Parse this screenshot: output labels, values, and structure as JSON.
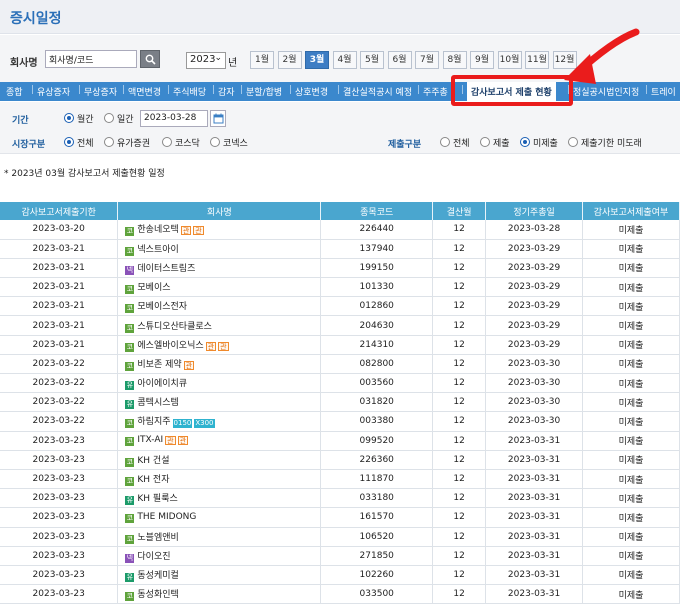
{
  "page": {
    "title": "증시일정"
  },
  "search": {
    "company_label": "회사명",
    "company_value": "회사명/코드",
    "year_value": "2023",
    "year_unit": "년",
    "months": [
      "1월",
      "2월",
      "3월",
      "4월",
      "5월",
      "6월",
      "7월",
      "8월",
      "9월",
      "10월",
      "11월",
      "12월"
    ],
    "active_month": "3월"
  },
  "tabs": [
    "종합",
    "유상증자",
    "무상증자",
    "액면변경",
    "주식배당",
    "감자",
    "분할/합병",
    "상호변경",
    "결산실적공시 예정",
    "주주총",
    "감사보고서 제출 현황",
    "정실공시법인지정",
    "트레이"
  ],
  "active_tab": "감사보고서 제출 현황",
  "filters": {
    "period_label": "기간",
    "monthly_label": "월간",
    "daily_label": "일간",
    "date_value": "2023-03-28",
    "market_label": "시장구분",
    "market_options": [
      "전체",
      "유가증권",
      "코스닥",
      "코넥스"
    ],
    "submit_label": "제출구분",
    "submit_options": [
      "전체",
      "제출",
      "미제출",
      "제출기한 미도래"
    ]
  },
  "notice": "* 2023년 03월 감사보고서 제출현황 일정",
  "table": {
    "headers": [
      "감사보고서제출기한",
      "회사명",
      "종목코드",
      "결산월",
      "정기주총일",
      "감사보고서제출여부"
    ],
    "rows": [
      {
        "deadline": "2023-03-20",
        "market": "코",
        "name": "한송네오텍",
        "code": "226440",
        "fiscal": "12",
        "meeting": "2023-03-28",
        "status": "미제출",
        "badges": [
          "관",
          "관"
        ]
      },
      {
        "deadline": "2023-03-21",
        "market": "코",
        "name": "넥스트아이",
        "code": "137940",
        "fiscal": "12",
        "meeting": "2023-03-29",
        "status": "미제출",
        "badges": []
      },
      {
        "deadline": "2023-03-21",
        "market": "넥",
        "name": "데이터스트림즈",
        "code": "199150",
        "fiscal": "12",
        "meeting": "2023-03-29",
        "status": "미제출",
        "badges": []
      },
      {
        "deadline": "2023-03-21",
        "market": "코",
        "name": "모베이스",
        "code": "101330",
        "fiscal": "12",
        "meeting": "2023-03-29",
        "status": "미제출",
        "badges": []
      },
      {
        "deadline": "2023-03-21",
        "market": "코",
        "name": "모베이스전자",
        "code": "012860",
        "fiscal": "12",
        "meeting": "2023-03-29",
        "status": "미제출",
        "badges": []
      },
      {
        "deadline": "2023-03-21",
        "market": "코",
        "name": "스튜디오산타클로스",
        "code": "204630",
        "fiscal": "12",
        "meeting": "2023-03-29",
        "status": "미제출",
        "badges": []
      },
      {
        "deadline": "2023-03-21",
        "market": "코",
        "name": "에스엘바이오닉스",
        "code": "214310",
        "fiscal": "12",
        "meeting": "2023-03-29",
        "status": "미제출",
        "badges": [
          "관",
          "관"
        ]
      },
      {
        "deadline": "2023-03-22",
        "market": "코",
        "name": "비보존 제약",
        "code": "082800",
        "fiscal": "12",
        "meeting": "2023-03-30",
        "status": "미제출",
        "badges": [
          "관"
        ]
      },
      {
        "deadline": "2023-03-22",
        "market": "유",
        "name": "아이에이치큐",
        "code": "003560",
        "fiscal": "12",
        "meeting": "2023-03-30",
        "status": "미제출",
        "badges": []
      },
      {
        "deadline": "2023-03-22",
        "market": "유",
        "name": "콤텍시스템",
        "code": "031820",
        "fiscal": "12",
        "meeting": "2023-03-30",
        "status": "미제출",
        "badges": []
      },
      {
        "deadline": "2023-03-22",
        "market": "코",
        "name": "하림지주",
        "code": "003380",
        "fiscal": "12",
        "meeting": "2023-03-30",
        "status": "미제출",
        "badges": [
          "0150",
          "X300"
        ]
      },
      {
        "deadline": "2023-03-23",
        "market": "코",
        "name": "ITX-AI",
        "code": "099520",
        "fiscal": "12",
        "meeting": "2023-03-31",
        "status": "미제출",
        "badges": [
          "관",
          "관"
        ]
      },
      {
        "deadline": "2023-03-23",
        "market": "코",
        "name": "KH 건설",
        "code": "226360",
        "fiscal": "12",
        "meeting": "2023-03-31",
        "status": "미제출",
        "badges": []
      },
      {
        "deadline": "2023-03-23",
        "market": "코",
        "name": "KH 전자",
        "code": "111870",
        "fiscal": "12",
        "meeting": "2023-03-31",
        "status": "미제출",
        "badges": []
      },
      {
        "deadline": "2023-03-23",
        "market": "유",
        "name": "KH 필룩스",
        "code": "033180",
        "fiscal": "12",
        "meeting": "2023-03-31",
        "status": "미제출",
        "badges": []
      },
      {
        "deadline": "2023-03-23",
        "market": "코",
        "name": "THE MIDONG",
        "code": "161570",
        "fiscal": "12",
        "meeting": "2023-03-31",
        "status": "미제출",
        "badges": []
      },
      {
        "deadline": "2023-03-23",
        "market": "코",
        "name": "노블엠앤비",
        "code": "106520",
        "fiscal": "12",
        "meeting": "2023-03-31",
        "status": "미제출",
        "badges": []
      },
      {
        "deadline": "2023-03-23",
        "market": "넥",
        "name": "다이오진",
        "code": "271850",
        "fiscal": "12",
        "meeting": "2023-03-31",
        "status": "미제출",
        "badges": []
      },
      {
        "deadline": "2023-03-23",
        "market": "유",
        "name": "동성케미컬",
        "code": "102260",
        "fiscal": "12",
        "meeting": "2023-03-31",
        "status": "미제출",
        "badges": []
      },
      {
        "deadline": "2023-03-23",
        "market": "코",
        "name": "동성화인텍",
        "code": "033500",
        "fiscal": "12",
        "meeting": "2023-03-31",
        "status": "미제출",
        "badges": []
      }
    ]
  },
  "colors": {
    "tab_bar": "#3b88cd",
    "header": "#4aa6cf",
    "highlight": "#ea1c1c",
    "active_month": "#3d7dc4"
  }
}
